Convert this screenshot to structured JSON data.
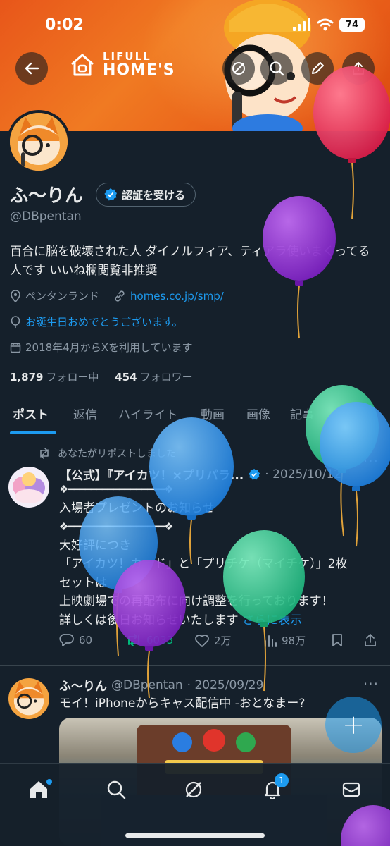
{
  "status_bar": {
    "time": "0:02",
    "battery": "74"
  },
  "banner": {
    "brand_top": "LIFULL",
    "brand_bottom": "HOME'S"
  },
  "profile": {
    "name": "ふ〜りん",
    "verify_label": "認証を受ける",
    "handle": "@DBpentan",
    "bio": "百合に脳を破壊された人 ダイノルフィア、ティアラ使いまくってる人です いいね欄閲覧非推奨",
    "location": "ペンタンランド",
    "website": "homes.co.jp/smp/",
    "birthday": "お誕生日おめでとうございます。",
    "joined": "2018年4月からXを利用しています",
    "following_count": "1,879",
    "following_label": "フォロー中",
    "followers_count": "454",
    "followers_label": "フォロワー"
  },
  "tabs": [
    "ポスト",
    "返信",
    "ハイライト",
    "動画",
    "画像",
    "記事"
  ],
  "posts": [
    {
      "repost_note": "あなたがリポストしました",
      "author": "【公式】『アイカツ！×プリパラ...",
      "date": "· 2025/10/12",
      "lines": [
        "❖━━━━━━━━━━━━━━━━━❖",
        "入場者プレゼントのお知らせ",
        "❖━━━━━━━━━━━━━━━━━❖",
        "大好評につき",
        "「アイカツ！カード」と「プリチケ（マイチケ）」2枚",
        "セットは",
        "上映劇場での再配布に向け調整を行っております！",
        "詳しくは後日お知らせいたします"
      ],
      "show_more": "さらに表示",
      "replies": "60",
      "reposts": "6033",
      "likes": "2万",
      "views": "98万"
    },
    {
      "author": "ふ〜りん",
      "handle": "@DBpentan",
      "date": "· 2025/09/29",
      "text": "モイ！iPhoneからキャス配信中 -おとなまー?"
    }
  ],
  "nav": {
    "notification_badge": "1"
  },
  "fab_label": "+",
  "colors": {
    "accent": "#1d9bf0",
    "background": "#15202b",
    "banner": "#f07a22",
    "repost_green": "#00ba7c"
  }
}
